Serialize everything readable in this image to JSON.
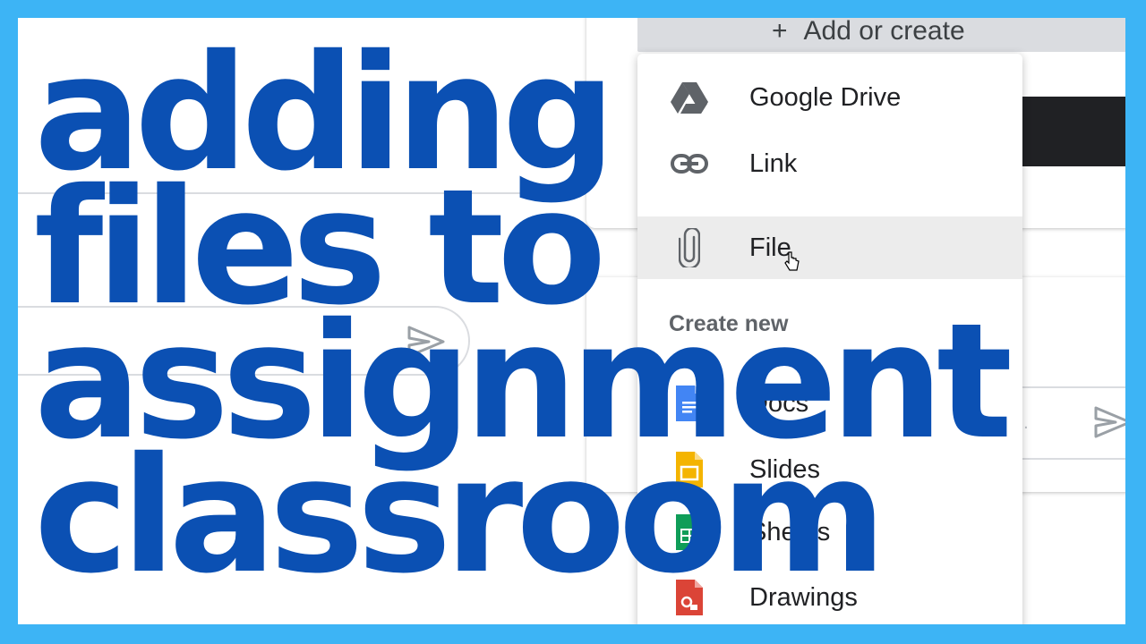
{
  "header": {
    "add_or_create_label": "Add or create"
  },
  "menu": {
    "items": [
      {
        "label": "Google Drive",
        "icon": "google-drive-icon"
      },
      {
        "label": "Link",
        "icon": "link-icon"
      },
      {
        "label": "File",
        "icon": "paperclip-icon",
        "hovered": true
      }
    ],
    "create_new": {
      "header": "Create new",
      "items": [
        {
          "label": "Docs",
          "icon": "google-docs-icon",
          "color": "#4285f4"
        },
        {
          "label": "Slides",
          "icon": "google-slides-icon",
          "color": "#f4b400"
        },
        {
          "label": "Sheets",
          "icon": "google-sheets-icon",
          "color": "#0f9d58"
        },
        {
          "label": "Drawings",
          "icon": "google-drawings-icon",
          "color": "#db4437"
        }
      ]
    }
  },
  "overlay_title": {
    "lines": [
      "adding",
      "files to",
      "assignment",
      "classroom"
    ],
    "color": "#0b50b3"
  },
  "colors": {
    "frame_border": "#3db4f5",
    "background": "#ffffff"
  }
}
